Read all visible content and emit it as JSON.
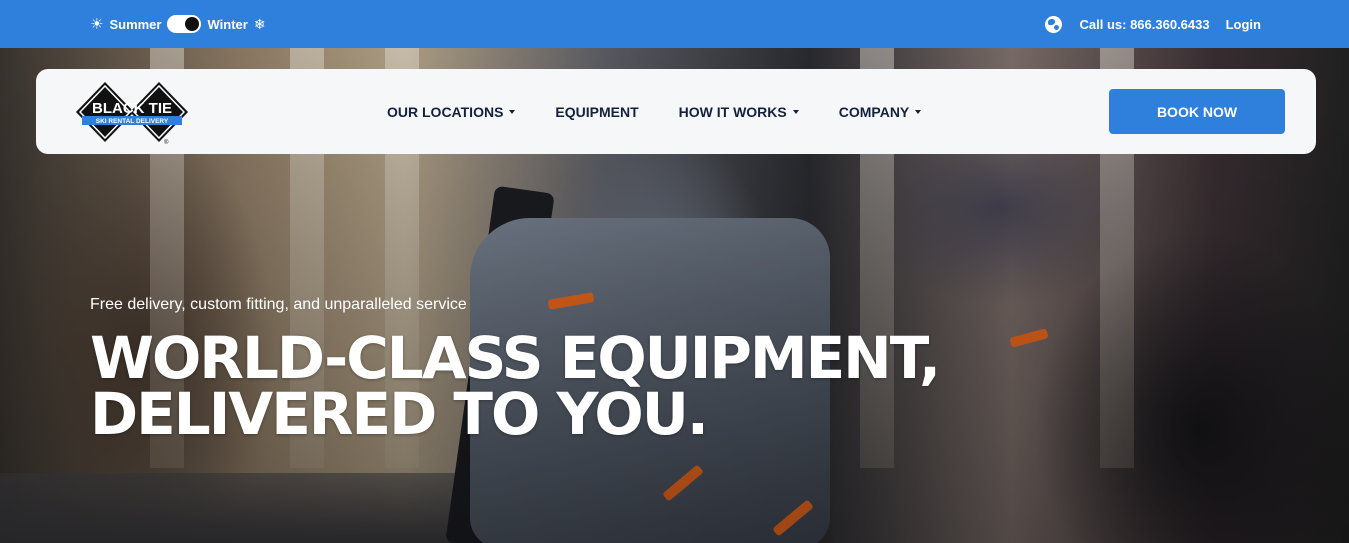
{
  "topbar": {
    "season_summer": "Summer",
    "season_winter": "Winter",
    "season_selected": "Winter",
    "call_text": "Call us: 866.360.6433",
    "login": "Login",
    "bg_color": "#2f80dc"
  },
  "logo": {
    "name": "BLACK TIE",
    "tagline": "SKI RENTAL DELIVERY",
    "mark": "®"
  },
  "nav": {
    "items": [
      {
        "label": "OUR LOCATIONS",
        "has_dropdown": true
      },
      {
        "label": "EQUIPMENT",
        "has_dropdown": false
      },
      {
        "label": "HOW IT WORKS",
        "has_dropdown": true
      },
      {
        "label": "COMPANY",
        "has_dropdown": true
      }
    ],
    "cta": "BOOK NOW",
    "cta_color": "#2f80dc",
    "text_color": "#14213d"
  },
  "hero": {
    "subline": "Free delivery, custom fitting, and unparalleled service",
    "headline_line1": "WORLD-CLASS EQUIPMENT,",
    "headline_line2": "DELIVERED TO YOU."
  },
  "icons": {
    "sun": "sun-icon",
    "snowflake": "snowflake-icon",
    "globe": "globe-icon",
    "caret": "chevron-down-icon"
  }
}
